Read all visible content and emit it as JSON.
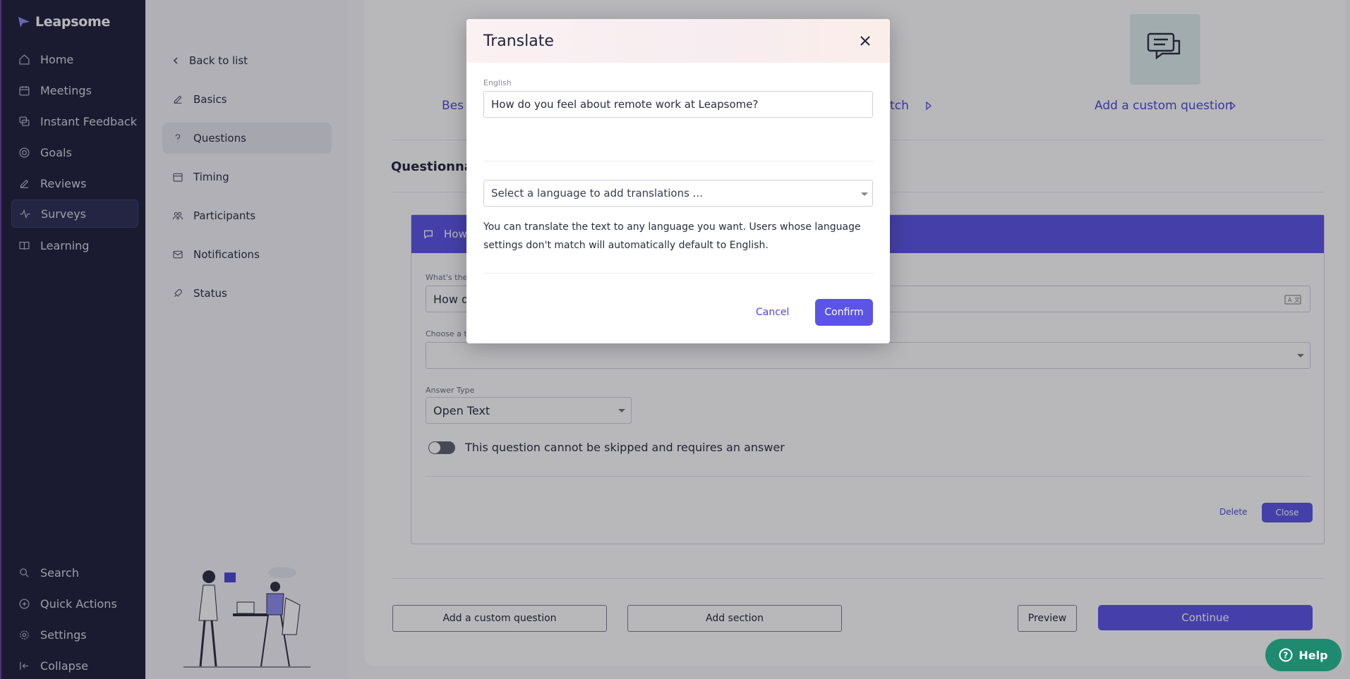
{
  "nav": {
    "brand": "Leapsome",
    "items": [
      {
        "label": "Home",
        "icon": "home-icon"
      },
      {
        "label": "Meetings",
        "icon": "calendar-icon"
      },
      {
        "label": "Instant Feedback",
        "icon": "feedback-icon"
      },
      {
        "label": "Goals",
        "icon": "target-icon"
      },
      {
        "label": "Reviews",
        "icon": "edit-icon"
      },
      {
        "label": "Surveys",
        "icon": "pulse-icon"
      },
      {
        "label": "Learning",
        "icon": "book-icon"
      }
    ],
    "bottom": [
      {
        "label": "Search",
        "icon": "search-icon"
      },
      {
        "label": "Quick Actions",
        "icon": "plus-circle-icon"
      },
      {
        "label": "Settings",
        "icon": "gear-icon"
      },
      {
        "label": "Collapse",
        "icon": "collapse-icon"
      }
    ]
  },
  "subnav": {
    "back": "Back to list",
    "items": [
      {
        "label": "Basics",
        "icon": "edit-icon"
      },
      {
        "label": "Questions",
        "icon": "question-icon"
      },
      {
        "label": "Timing",
        "icon": "calendar-icon"
      },
      {
        "label": "Participants",
        "icon": "users-icon"
      },
      {
        "label": "Notifications",
        "icon": "mail-icon"
      },
      {
        "label": "Status",
        "icon": "rocket-icon"
      }
    ]
  },
  "main": {
    "top_links": [
      "Bes",
      "Match",
      "Add a custom question"
    ],
    "section_title": "Questionnaire",
    "question": {
      "header": "How do y",
      "question_label": "What's the quest",
      "question_value": "How do yo",
      "topic_label": "Choose a topic",
      "answer_type_label": "Answer Type",
      "answer_type_value": "Open Text",
      "required_text": "This question cannot be skipped and requires an answer",
      "delete": "Delete",
      "close": "Close"
    },
    "footer": {
      "add_custom": "Add a custom question",
      "add_section": "Add section",
      "preview": "Preview",
      "continue": "Continue"
    }
  },
  "modal": {
    "title": "Translate",
    "language_label": "English",
    "source_text": "How do you feel about remote work at Leapsome?",
    "select_placeholder": "Select a language to add translations ...",
    "help_text": "You can translate the text to any language you want. Users whose language settings don't match will automatically default to English.",
    "cancel": "Cancel",
    "confirm": "Confirm"
  },
  "help_button": "Help",
  "colors": {
    "accent": "#5b54e6",
    "nav_bg": "#1e1f3a",
    "help_bg": "#1f8a70"
  }
}
